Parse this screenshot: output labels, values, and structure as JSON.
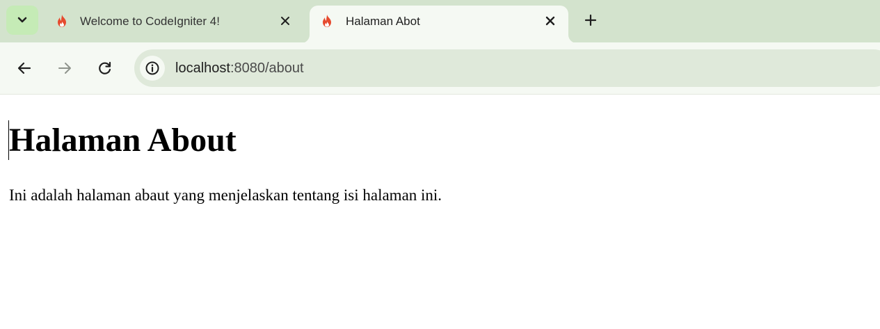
{
  "browser": {
    "tabs": [
      {
        "title": "Welcome to CodeIgniter 4!",
        "favicon": "codeigniter-flame-icon",
        "active": false
      },
      {
        "title": "Halaman Abot",
        "favicon": "codeigniter-flame-icon",
        "active": true
      }
    ],
    "address": {
      "host": "localhost",
      "path": ":8080/about"
    },
    "icons": {
      "tab_search": "chevron-down-icon",
      "close": "close-icon",
      "new_tab": "plus-icon",
      "back": "arrow-left-icon",
      "forward": "arrow-right-icon",
      "reload": "reload-icon",
      "site_info": "info-icon"
    },
    "colors": {
      "tabstrip": "#d3e3cd",
      "toolbar": "#f5f9f3",
      "omnibox": "#dfe9da",
      "favicon": "#e64a2e"
    }
  },
  "page": {
    "heading": "Halaman About",
    "paragraph": "Ini adalah halaman abaut yang menjelaskan tentang isi halaman ini."
  }
}
